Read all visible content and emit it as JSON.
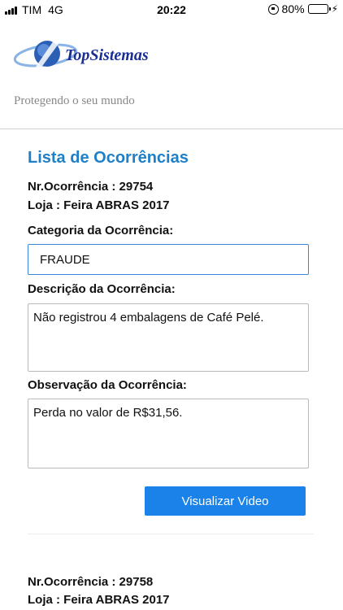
{
  "status_bar": {
    "carrier": "TIM",
    "network": "4G",
    "time": "20:22",
    "battery": "80%",
    "battery_level": 0.8,
    "battery_color": "#3bb54a"
  },
  "header": {
    "logo_text": "TopSistemas",
    "tagline": "Protegendo o seu mundo"
  },
  "page": {
    "title": "Lista de Ocorrências",
    "accent": "#1f7fc7"
  },
  "occurrences": [
    {
      "number_line": "Nr.Ocorrência : 29754",
      "store_line": "Loja : Feira ABRAS 2017",
      "category_label": "Categoria da Ocorrência:",
      "category_value": "FRAUDE",
      "description_label": "Descrição da Ocorrência:",
      "description_value": "Não registrou 4 embalagens de Café Pelé.",
      "observation_label": "Observação da Ocorrência:",
      "observation_value": "Perda no valor de R$31,56.",
      "button_label": "Visualizar Video"
    },
    {
      "number_line": "Nr.Ocorrência : 29758",
      "store_line": "Loja : Feira ABRAS 2017"
    }
  ]
}
